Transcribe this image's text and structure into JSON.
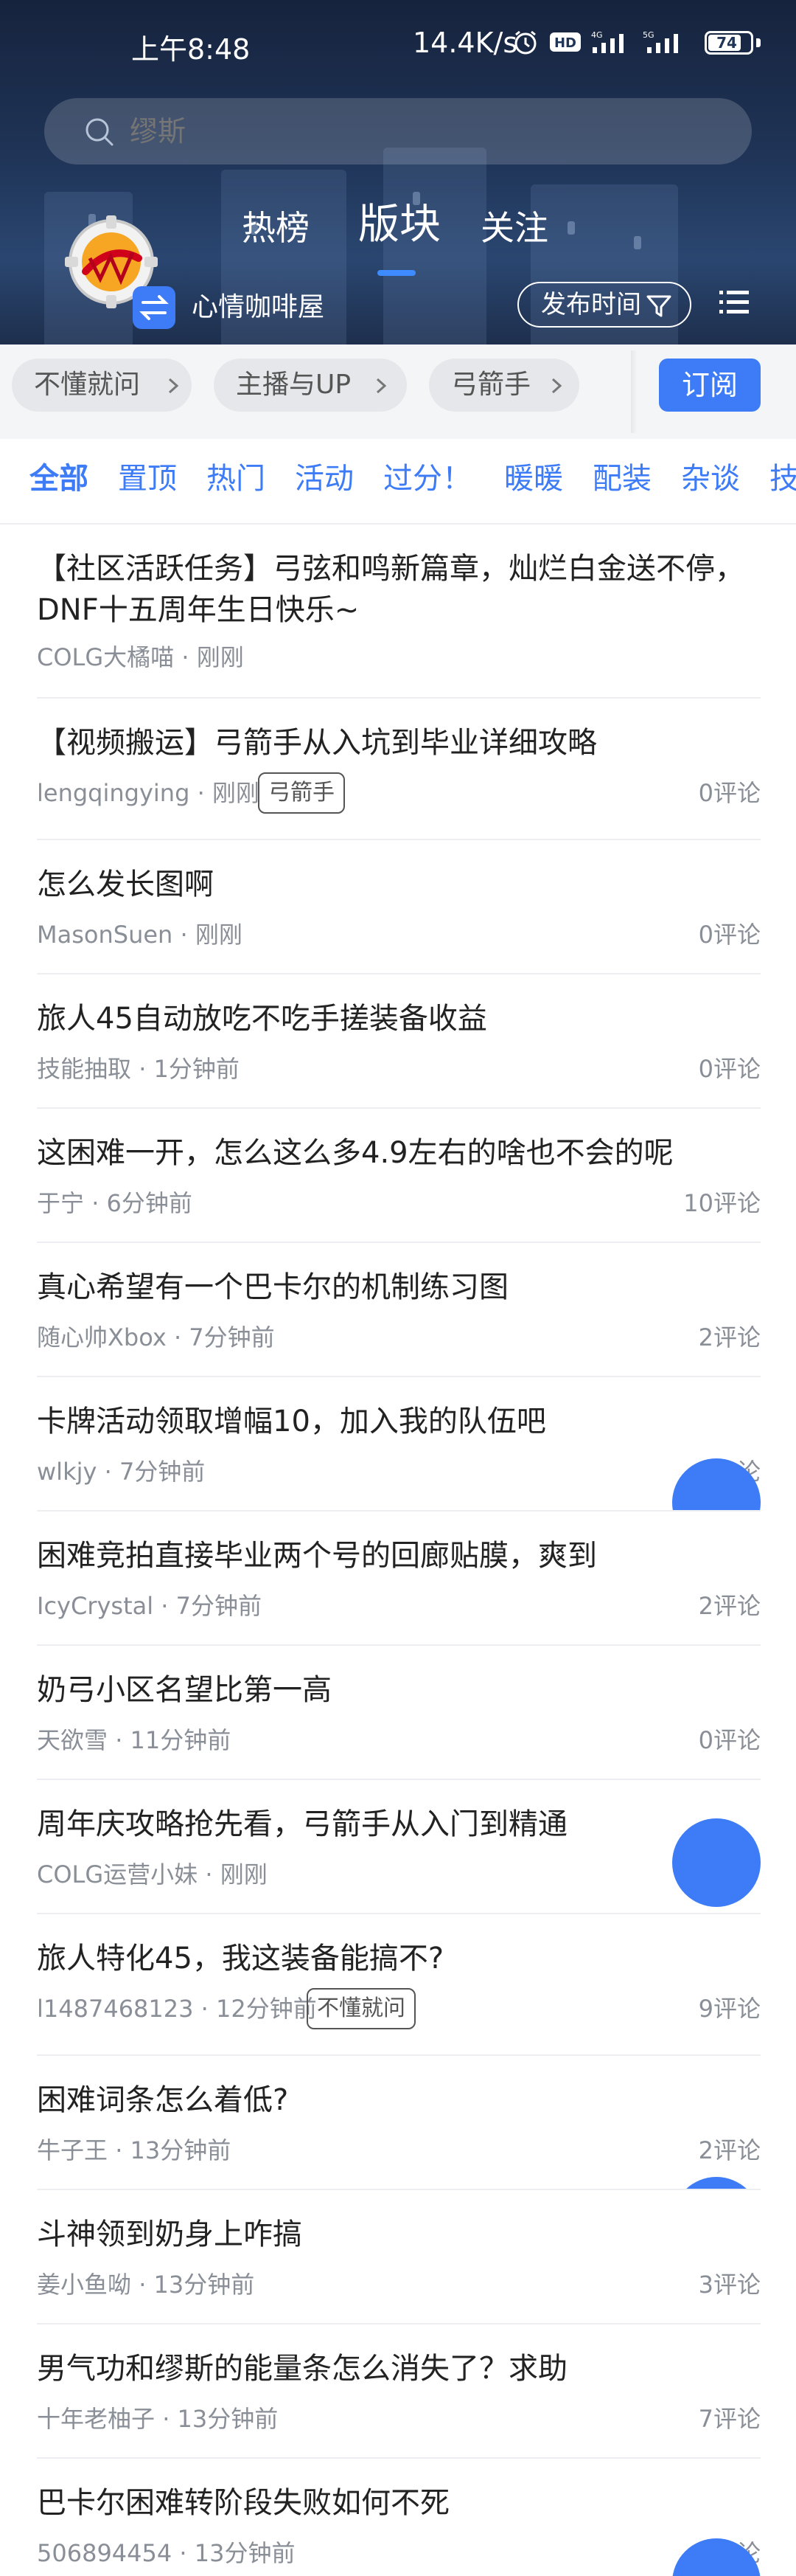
{
  "status_bar": {
    "time": "上午8:48",
    "network_speed": "14.4K/s",
    "battery": "74",
    "icons": [
      "alarm-icon",
      "hd-icon",
      "signal-4g-icon",
      "signal-5g-icon",
      "battery-icon"
    ]
  },
  "search": {
    "placeholder": "缪斯"
  },
  "tabs": [
    {
      "label": "热榜",
      "active": false
    },
    {
      "label": "版块",
      "active": true
    },
    {
      "label": "关注",
      "active": false
    }
  ],
  "forum": {
    "name": "心情咖啡屋",
    "sort_label": "发布时间"
  },
  "subforums": [
    {
      "label": "不懂就问"
    },
    {
      "label": "主播与UP"
    },
    {
      "label": "弓箭手"
    }
  ],
  "subscribe_label": "订阅",
  "categories": [
    {
      "label": "全部",
      "active": true
    },
    {
      "label": "置顶"
    },
    {
      "label": "热门"
    },
    {
      "label": "活动"
    },
    {
      "label": "过分！"
    },
    {
      "label": "暖暖"
    },
    {
      "label": "配装"
    },
    {
      "label": "杂谈"
    },
    {
      "label": "技"
    }
  ],
  "posts": [
    {
      "title": "【社区活跃任务】弓弦和鸣新篇章，灿烂白金送不停，DNF十五周年生日快乐~",
      "author": "COLG大橘喵",
      "time": "刚刚",
      "tag": "",
      "comments": ""
    },
    {
      "title": "【视频搬运】弓箭手从入坑到毕业详细攻略",
      "author": "lengqingying",
      "time": "刚刚",
      "tag": "弓箭手",
      "comments": "0评论"
    },
    {
      "title": "怎么发长图啊",
      "author": "MasonSuen",
      "time": "刚刚",
      "tag": "",
      "comments": "0评论"
    },
    {
      "title": "旅人45自动放吃不吃手搓装备收益",
      "author": "技能抽取",
      "time": "1分钟前",
      "tag": "",
      "comments": "0评论"
    },
    {
      "title": "这困难一开，怎么这么多4.9左右的啥也不会的呢",
      "author": "于宁",
      "time": "6分钟前",
      "tag": "",
      "comments": "10评论"
    },
    {
      "title": "真心希望有一个巴卡尔的机制练习图",
      "author": "随心帅Xbox",
      "time": "7分钟前",
      "tag": "",
      "comments": "2评论"
    },
    {
      "title": "卡牌活动领取增幅10，加入我的队伍吧",
      "author": "wlkjy",
      "time": "7分钟前",
      "tag": "",
      "comments": "论"
    },
    {
      "title": "困难竞拍直接毕业两个号的回廊贴膜，爽到",
      "author": "IcyCrystal",
      "time": "7分钟前",
      "tag": "",
      "comments": "2评论"
    },
    {
      "title": "奶弓小区名望比第一高",
      "author": "天欲雪",
      "time": "11分钟前",
      "tag": "",
      "comments": "0评论"
    },
    {
      "title": "周年庆攻略抢先看，弓箭手从入门到精通",
      "author": "COLG运营小妹",
      "time": "刚刚",
      "tag": "",
      "comments": ""
    },
    {
      "title": "旅人特化45，我这装备能搞不?",
      "author": "l1487468123",
      "time": "12分钟前",
      "tag": "不懂就问",
      "comments": "9评论"
    },
    {
      "title": "困难词条怎么着低?",
      "author": "牛子王",
      "time": "13分钟前",
      "tag": "",
      "comments": "2评论"
    },
    {
      "title": "斗神领到奶身上咋搞",
      "author": "姜小鱼呦",
      "time": "13分钟前",
      "tag": "",
      "comments": "3评论"
    },
    {
      "title": "男气功和缪斯的能量条怎么消失了？求助",
      "author": "十年老柚子",
      "time": "13分钟前",
      "tag": "",
      "comments": "7评论"
    },
    {
      "title": "巴卡尔困难转阶段失败如何不死",
      "author": "506894454",
      "time": "13分钟前",
      "tag": "",
      "comments": "论"
    }
  ],
  "colors": {
    "accent": "#3d7cf6",
    "header_bg": "#1f3457",
    "text": "#222222",
    "meta": "#8a8f97"
  }
}
